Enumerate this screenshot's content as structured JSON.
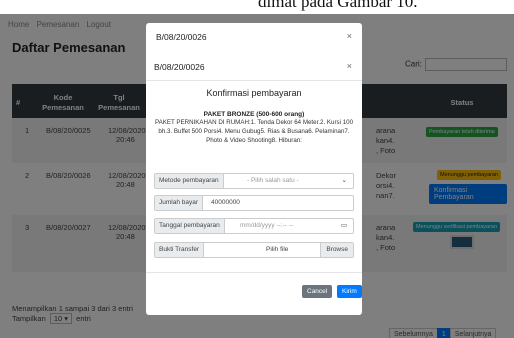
{
  "caption_fragment": "dimat pada Gambar 10.",
  "nav": [
    "Home",
    "Pemesanan",
    "Logout"
  ],
  "page_title": "Daftar Pemesanan",
  "search_label": "Cari:",
  "table": {
    "headers": [
      "#",
      "Kode Pemesanan",
      "Tgl Pemesanan",
      "Status"
    ],
    "rows": [
      {
        "no": "1",
        "kode": "B/08/20/0025",
        "tgl": "12/08/2020",
        "jam": "20:46",
        "frag": "arana\nkan4.\n, Foto",
        "status": "Pembayaran telah diterima"
      },
      {
        "no": "2",
        "kode": "B/08/20/0026",
        "tgl": "12/08/2020",
        "jam": "20:48",
        "frag": "Dekor\norsi4.\nnan7.",
        "status": "Menunggu pembayaran",
        "action": "Konfirmasi Pembayaran"
      },
      {
        "no": "3",
        "kode": "B/08/20/0027",
        "tgl": "12/08/2020",
        "jam": "20:48",
        "frag": "arana\nkan4.\n, Foto",
        "status": "Menunggu verifikasi pembayaran"
      }
    ]
  },
  "footer_info": "Menampilkan 1 sampai 3 dari 3 entri",
  "footer_show": {
    "prefix": "Tampilkan",
    "value": "10",
    "suffix": "entri"
  },
  "pager": {
    "prev": "Sebelumnya",
    "page": "1",
    "next": "Selanjutnya"
  },
  "modal_back": {
    "title": "B/08/20/0026",
    "close": "×"
  },
  "modal": {
    "title": "B/08/20/0026",
    "close": "×",
    "heading": "Konfirmasi pembayaran",
    "package": "PAKET BRONZE (500-600 orang)",
    "description": "PAKET PERNIKAHAN DI RUMAH:1. Tenda Dekor 64 Meter.2. Kursi 100 bh.3. Buffet 500 Porsi4. Menu Gubug5. Rias & Busana6. Pelaminan7. Photo & Video Shooting8. Hiburan:",
    "method_label": "Metode pembayaran",
    "method_placeholder": "- Pilih salah satu -",
    "amount_label": "Jumlah bayar",
    "amount_value": "40000000",
    "date_label": "Tanggal pembayaran",
    "date_placeholder": "mm/dd/yyyy --:-- --",
    "proof_label": "Bukti Transfer",
    "proof_placeholder": "Pilih file",
    "browse": "Browse",
    "cancel": "Cancel",
    "submit": "Kirim"
  }
}
